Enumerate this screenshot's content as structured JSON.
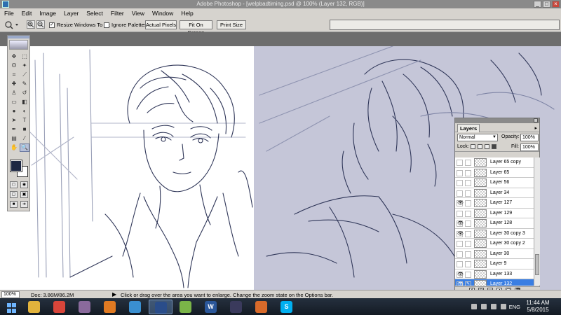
{
  "window": {
    "title": "Adobe Photoshop - [welpbadtiming.psd @ 100% (Layer 132, RGB)]",
    "min_label": "_",
    "max_label": "□",
    "close_label": "×"
  },
  "menubar": {
    "items": [
      "File",
      "Edit",
      "Image",
      "Layer",
      "Select",
      "Filter",
      "View",
      "Window",
      "Help"
    ]
  },
  "options": {
    "resize_windows_label": "Resize Windows To Fit",
    "resize_windows_checked": true,
    "ignore_palettes_label": "Ignore Palettes",
    "ignore_palettes_checked": false,
    "actual_pixels_label": "Actual Pixels",
    "fit_on_screen_label": "Fit On Screen",
    "print_size_label": "Print Size",
    "check_mark": "✓"
  },
  "tools": [
    {
      "name": "move-icon",
      "glyph": "✥"
    },
    {
      "name": "marquee-icon",
      "glyph": "⬚"
    },
    {
      "name": "lasso-icon",
      "glyph": "ʘ"
    },
    {
      "name": "magic-wand-icon",
      "glyph": "✦"
    },
    {
      "name": "crop-icon",
      "glyph": "⌗"
    },
    {
      "name": "slice-icon",
      "glyph": "⟋"
    },
    {
      "name": "healing-brush-icon",
      "glyph": "✚"
    },
    {
      "name": "brush-icon",
      "glyph": "✎"
    },
    {
      "name": "clone-stamp-icon",
      "glyph": "♙"
    },
    {
      "name": "history-brush-icon",
      "glyph": "↺"
    },
    {
      "name": "eraser-icon",
      "glyph": "▭"
    },
    {
      "name": "gradient-icon",
      "glyph": "◧"
    },
    {
      "name": "blur-icon",
      "glyph": "●"
    },
    {
      "name": "dodge-icon",
      "glyph": "◐"
    },
    {
      "name": "path-selection-icon",
      "glyph": "➤"
    },
    {
      "name": "type-icon",
      "glyph": "T"
    },
    {
      "name": "pen-icon",
      "glyph": "✒"
    },
    {
      "name": "shape-icon",
      "glyph": "■"
    },
    {
      "name": "notes-icon",
      "glyph": "▤"
    },
    {
      "name": "eyedropper-icon",
      "glyph": "⁄"
    },
    {
      "name": "hand-icon",
      "glyph": "✋"
    },
    {
      "name": "zoom-icon",
      "glyph": "🔍"
    }
  ],
  "active_tool_index": 21,
  "colors": {
    "foreground": "#1d2742",
    "background": "#ffffff",
    "canvas_right_bg": "#c5c6d8",
    "line_color": "#2f3658",
    "selection": "#3a7ee2"
  },
  "layers": {
    "tab_label": "Layers",
    "panel_menu": "▸",
    "blend_mode": "Normal",
    "opacity_label": "Opacity:",
    "opacity_value": "100%",
    "lock_label": "Lock:",
    "fill_label": "Fill:",
    "fill_value": "100%",
    "items": [
      {
        "name": "Layer 65 copy",
        "visible": false,
        "selected": false
      },
      {
        "name": "Layer 65",
        "visible": false,
        "selected": false
      },
      {
        "name": "Layer 56",
        "visible": false,
        "selected": false
      },
      {
        "name": "Layer 34",
        "visible": false,
        "selected": false
      },
      {
        "name": "Layer 127",
        "visible": true,
        "selected": false
      },
      {
        "name": "Layer 129",
        "visible": false,
        "selected": false
      },
      {
        "name": "Layer 128",
        "visible": true,
        "selected": false
      },
      {
        "name": "Layer 30 copy 3",
        "visible": true,
        "selected": false
      },
      {
        "name": "Layer 30 copy 2",
        "visible": false,
        "selected": false
      },
      {
        "name": "Layer 30",
        "visible": false,
        "selected": false
      },
      {
        "name": "Layer 9",
        "visible": false,
        "selected": false
      },
      {
        "name": "Layer 133",
        "visible": true,
        "selected": false
      },
      {
        "name": "Layer 132",
        "visible": true,
        "selected": true
      }
    ]
  },
  "statusbar": {
    "zoom": "100%",
    "doc": "Doc: 3.86M/86.2M",
    "arrow": "▶",
    "hint": "Click or drag over the area you want to enlarge. Change the zoom state on the Options bar."
  },
  "taskbar": {
    "apps": [
      {
        "name": "file-explorer-icon",
        "color": "#e2b33c",
        "label": ""
      },
      {
        "name": "chrome-icon",
        "color": "#d8453a",
        "label": ""
      },
      {
        "name": "app-icon-3",
        "color": "#8a6a9c",
        "label": ""
      },
      {
        "name": "firefox-icon",
        "color": "#e07a22",
        "label": ""
      },
      {
        "name": "app-icon-5",
        "color": "#3a8fd0",
        "label": ""
      },
      {
        "name": "photoshop-icon",
        "color": "#2a4d8a",
        "label": ""
      },
      {
        "name": "app-icon-7",
        "color": "#7ab448",
        "label": ""
      },
      {
        "name": "word-icon",
        "color": "#2b579a",
        "label": "W"
      },
      {
        "name": "media-icon",
        "color": "#3a3a5c",
        "label": ""
      },
      {
        "name": "app-icon-10",
        "color": "#d86a2a",
        "label": ""
      },
      {
        "name": "skype-icon",
        "color": "#00aff0",
        "label": "S"
      }
    ],
    "active_app_index": 5,
    "language": "ENG",
    "time": "11:44 AM",
    "date": "5/8/2015"
  }
}
